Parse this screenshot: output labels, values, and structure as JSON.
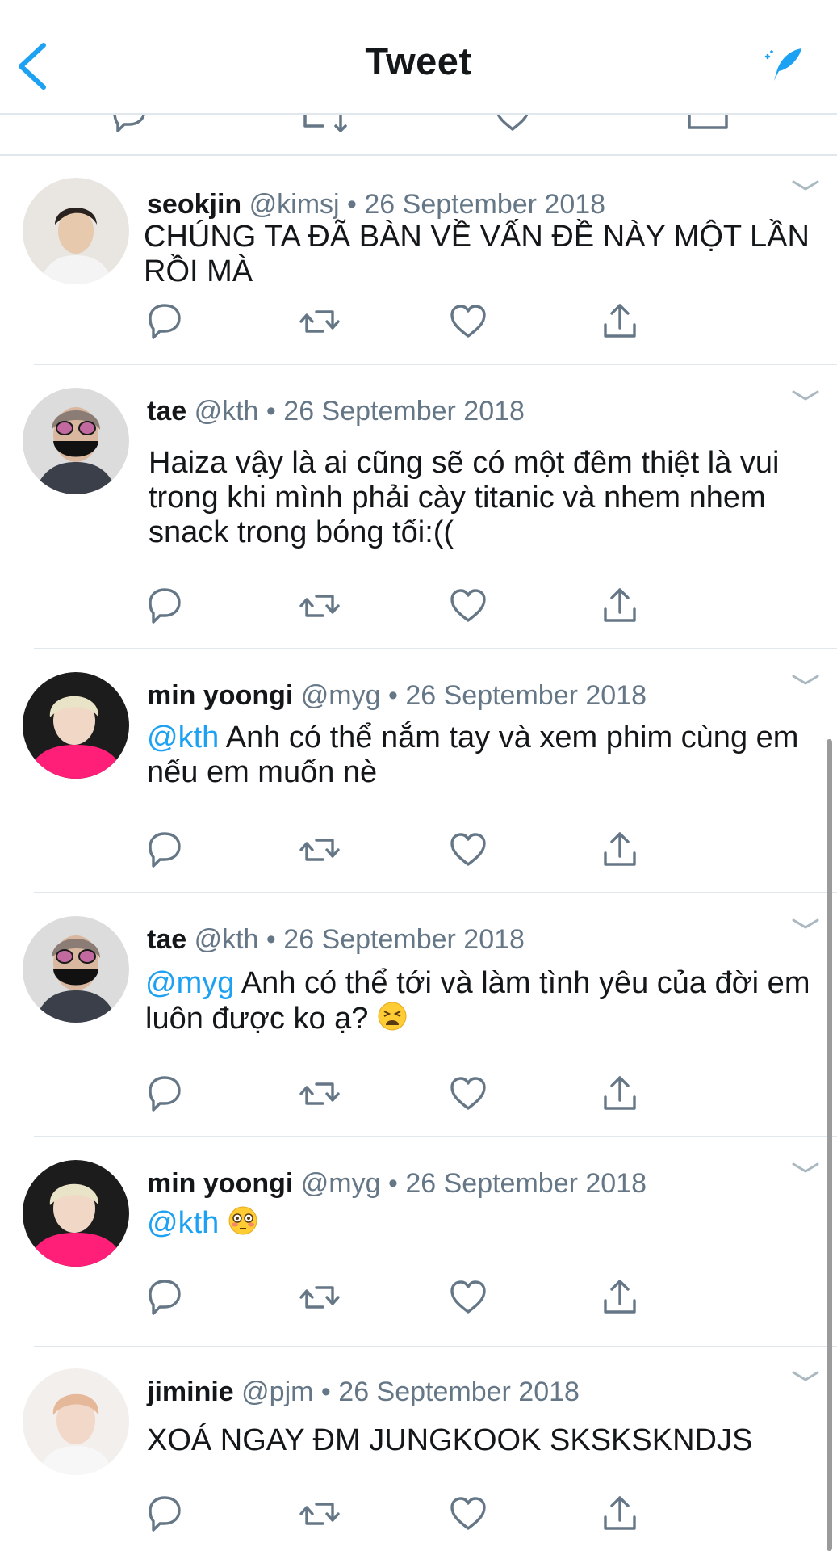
{
  "header": {
    "title": "Tweet",
    "back_icon": "chevron-left-icon",
    "compose_icon": "compose-feather-icon",
    "accent": "#1da1f2"
  },
  "tweets": [
    {
      "name": "seokjin",
      "handle": "@kimsj",
      "sep": "•",
      "date": "26 September 2018",
      "mention": "",
      "text": "CHÚNG TA ĐÃ BÀN VỀ VẤN ĐỀ NÀY MỘT LẦN RỒI MÀ",
      "emoji": ""
    },
    {
      "name": "tae",
      "handle": "@kth",
      "sep": "•",
      "date": "26 September 2018",
      "mention": "",
      "text": "Haiza vậy là ai cũng sẽ có một đêm thiệt là vui trong khi mình phải cày titanic và nhem nhem snack trong bóng tối:((",
      "emoji": ""
    },
    {
      "name": "min yoongi",
      "handle": "@myg",
      "sep": "•",
      "date": "26 September 2018",
      "mention": "@kth",
      "text": " Anh có thể nắm tay và xem phim cùng em nếu em muốn nè",
      "emoji": ""
    },
    {
      "name": "tae",
      "handle": "@kth",
      "sep": "•",
      "date": "26 September 2018",
      "mention": "@myg",
      "text": " Anh có thể tới và làm tình yêu của đời em luôn được ko ạ? ",
      "emoji": "tired-face"
    },
    {
      "name": "min yoongi",
      "handle": "@myg",
      "sep": "•",
      "date": "26 September 2018",
      "mention": "@kth",
      "text": " ",
      "emoji": "flushed-face"
    },
    {
      "name": "jiminie",
      "handle": "@pjm",
      "sep": "•",
      "date": "26 September 2018",
      "mention": "",
      "text": "XOÁ NGAY ĐM JUNGKOOK SKSKSKNDJS",
      "emoji": ""
    }
  ],
  "action_icons": [
    "reply-icon",
    "retweet-icon",
    "like-heart-icon",
    "share-icon"
  ],
  "colors": {
    "text": "#14171a",
    "secondary": "#657786",
    "icon": "#657786",
    "divider": "#e1e8ed",
    "mention": "#1da1f2"
  }
}
